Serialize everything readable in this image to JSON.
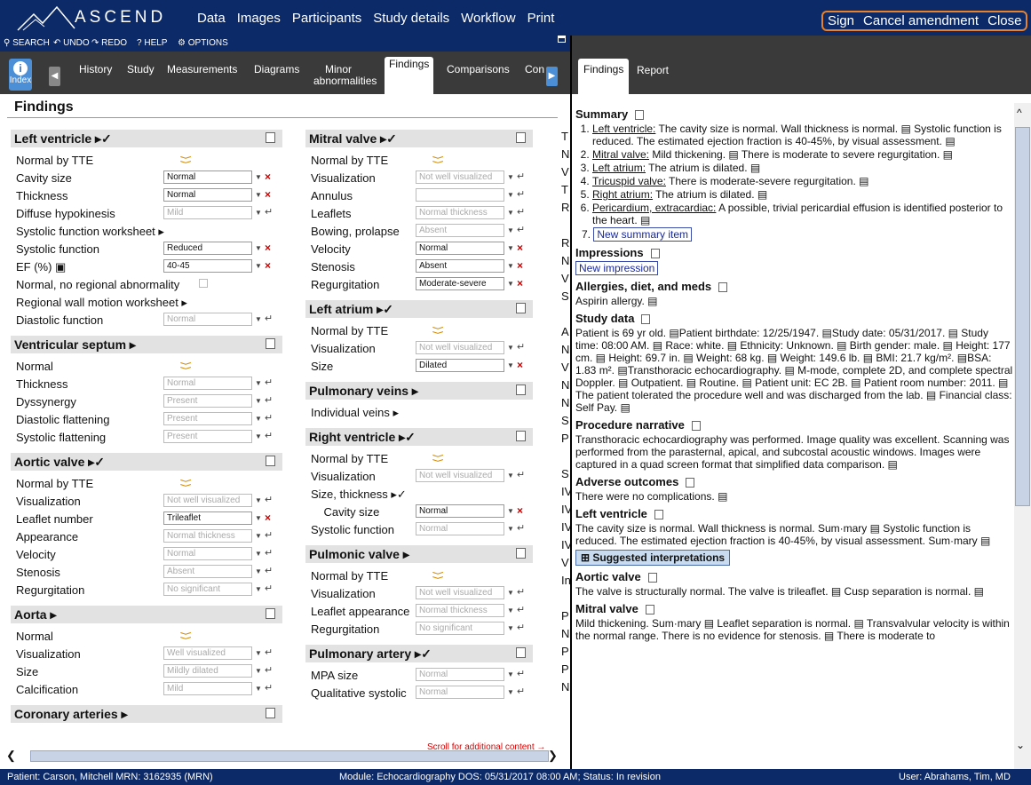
{
  "app": {
    "name": "ASCEND"
  },
  "menu": [
    "Data",
    "Images",
    "Participants",
    "Study details",
    "Workflow",
    "Print"
  ],
  "top_actions": [
    "Sign",
    "Cancel amendment",
    "Close"
  ],
  "toolbar": {
    "search": "SEARCH",
    "undo": "UNDO",
    "redo": "REDO",
    "help": "HELP",
    "options": "OPTIONS"
  },
  "left_tabs": {
    "index": "Index",
    "tabs": [
      "History",
      "Study",
      "Measurements",
      "Diagrams",
      "Minor abnormalities",
      "Findings",
      "Comparisons",
      "Con"
    ],
    "active": "Findings"
  },
  "right_tabs": {
    "tabs": [
      "Findings",
      "Report"
    ],
    "active": "Findings"
  },
  "findings": {
    "title": "Findings"
  },
  "col1": [
    {
      "title": "Left ventricle ▸✓",
      "rows": [
        {
          "label": "Normal by TTE",
          "ctrl": "chevron"
        },
        {
          "label": "Cavity size",
          "value": "Normal",
          "state": "set"
        },
        {
          "label": "Thickness",
          "value": "Normal",
          "state": "set"
        },
        {
          "label": "Diffuse hypokinesis",
          "value": "Mild",
          "state": "dis"
        },
        {
          "label": "Systolic function worksheet ▸",
          "ctrl": "none"
        },
        {
          "label": "Systolic function",
          "value": "Reduced",
          "state": "set"
        },
        {
          "label": "EF (%) ▣",
          "value": "40-45",
          "state": "set"
        },
        {
          "label": "Normal, no regional abnormality",
          "ctrl": "checkbox"
        },
        {
          "label": "Regional wall motion worksheet ▸",
          "ctrl": "none"
        },
        {
          "label": "Diastolic function",
          "value": "Normal",
          "state": "dis"
        }
      ]
    },
    {
      "title": "Ventricular septum ▸",
      "rows": [
        {
          "label": "Normal",
          "ctrl": "chevron"
        },
        {
          "label": "Thickness",
          "value": "Normal",
          "state": "dis"
        },
        {
          "label": "Dyssynergy",
          "value": "Present",
          "state": "dis"
        },
        {
          "label": "Diastolic flattening",
          "value": "Present",
          "state": "dis"
        },
        {
          "label": "Systolic flattening",
          "value": "Present",
          "state": "dis"
        }
      ]
    },
    {
      "title": "Aortic valve ▸✓",
      "rows": [
        {
          "label": "Normal by TTE",
          "ctrl": "chevron"
        },
        {
          "label": "Visualization",
          "value": "Not well visualized",
          "state": "dis"
        },
        {
          "label": "Leaflet number",
          "value": "Trileaflet",
          "state": "set"
        },
        {
          "label": "Appearance",
          "value": "Normal thickness",
          "state": "dis"
        },
        {
          "label": "Velocity",
          "value": "Normal",
          "state": "dis"
        },
        {
          "label": "Stenosis",
          "value": "Absent",
          "state": "dis"
        },
        {
          "label": "Regurgitation",
          "value": "No significant",
          "state": "dis"
        }
      ]
    },
    {
      "title": "Aorta ▸",
      "rows": [
        {
          "label": "Normal",
          "ctrl": "chevron"
        },
        {
          "label": "Visualization",
          "value": "Well visualized",
          "state": "dis"
        },
        {
          "label": "Size",
          "value": "Mildly dilated",
          "state": "dis"
        },
        {
          "label": "Calcification",
          "value": "Mild",
          "state": "dis"
        }
      ]
    },
    {
      "title": "Coronary arteries ▸",
      "rows": []
    }
  ],
  "col2": [
    {
      "title": "Mitral valve ▸✓",
      "rows": [
        {
          "label": "Normal by TTE",
          "ctrl": "chevron"
        },
        {
          "label": "Visualization",
          "value": "Not well visualized",
          "state": "dis"
        },
        {
          "label": "Annulus",
          "value": "",
          "state": "dis"
        },
        {
          "label": "Leaflets",
          "value": "Normal thickness",
          "state": "dis"
        },
        {
          "label": "Bowing, prolapse",
          "value": "Absent",
          "state": "dis"
        },
        {
          "label": "Velocity",
          "value": "Normal",
          "state": "set"
        },
        {
          "label": "Stenosis",
          "value": "Absent",
          "state": "set"
        },
        {
          "label": "Regurgitation",
          "value": "Moderate-severe",
          "state": "set"
        }
      ]
    },
    {
      "title": "Left atrium ▸✓",
      "rows": [
        {
          "label": "Normal by TTE",
          "ctrl": "chevron"
        },
        {
          "label": "Visualization",
          "value": "Not well visualized",
          "state": "dis"
        },
        {
          "label": "Size",
          "value": "Dilated",
          "state": "set"
        }
      ]
    },
    {
      "title": "Pulmonary veins ▸",
      "rows": [
        {
          "label": "Individual veins ▸",
          "ctrl": "none"
        }
      ]
    },
    {
      "title": "Right ventricle ▸✓",
      "rows": [
        {
          "label": "Normal by TTE",
          "ctrl": "chevron"
        },
        {
          "label": "Visualization",
          "value": "Not well visualized",
          "state": "dis"
        },
        {
          "label": "Size, thickness ▸✓",
          "ctrl": "none"
        },
        {
          "label": "    Cavity size",
          "value": "Normal",
          "state": "set"
        },
        {
          "label": "Systolic function",
          "value": "Normal",
          "state": "dis"
        }
      ]
    },
    {
      "title": "Pulmonic valve ▸",
      "rows": [
        {
          "label": "Normal by TTE",
          "ctrl": "chevron"
        },
        {
          "label": "Visualization",
          "value": "Not well visualized",
          "state": "dis"
        },
        {
          "label": "Leaflet appearance",
          "value": "Normal thickness",
          "state": "dis"
        },
        {
          "label": "Regurgitation",
          "value": "No significant",
          "state": "dis"
        }
      ]
    },
    {
      "title": "Pulmonary artery ▸✓",
      "rows": [
        {
          "label": "MPA size",
          "value": "Normal",
          "state": "dis"
        },
        {
          "label": "Qualitative systolic",
          "value": "Normal",
          "state": "dis"
        }
      ]
    }
  ],
  "col3_letters": [
    "T",
    "N",
    "V",
    "T",
    "R",
    "",
    "R",
    "N",
    "V",
    "S",
    "",
    "A",
    "N",
    "V",
    "N",
    "N",
    "S",
    "P",
    "",
    "S",
    "IV",
    "IV",
    "IV",
    "IV",
    "V",
    "In",
    "",
    "P",
    "N",
    "P",
    "P",
    "N"
  ],
  "scroll_msg": "Scroll for additional content →",
  "report": {
    "summary_heading": "Summary",
    "summary": [
      {
        "lead": "Left ventricle:",
        "text": " The cavity size is normal. Wall thickness is normal. ▤ Systolic function is reduced. The estimated ejection fraction is 40-45%, by visual assessment. ▤"
      },
      {
        "lead": "Mitral valve:",
        "text": " Mild thickening. ▤ There is moderate to severe regurgitation. ▤"
      },
      {
        "lead": "Left atrium:",
        "text": " The atrium is dilated. ▤"
      },
      {
        "lead": "Tricuspid valve:",
        "text": " There is moderate-severe regurgitation. ▤"
      },
      {
        "lead": "Right atrium:",
        "text": " The atrium is dilated. ▤"
      },
      {
        "lead": "Pericardium, extracardiac:",
        "text": " A possible, trivial pericardial effusion is identified posterior to the heart. ▤"
      }
    ],
    "new_summary": "New summary item",
    "impressions_heading": "Impressions",
    "new_impression": "New impression",
    "allergies_heading": "Allergies, diet, and meds",
    "allergies": "Aspirin allergy. ▤",
    "study_heading": "Study data",
    "study": "Patient is 69 yr old. ▤Patient birthdate: 12/25/1947. ▤Study date: 05/31/2017. ▤ Study time: 08:00 AM. ▤ Race: white. ▤ Ethnicity: Unknown. ▤ Birth gender: male. ▤ Height: 177 cm. ▤ Height: 69.7 in. ▤ Weight: 68 kg. ▤ Weight: 149.6 lb. ▤ BMI: 21.7 kg/m². ▤BSA: 1.83 m². ▤Transthoracic echocardiography. ▤ M-mode, complete 2D, and complete spectral Doppler. ▤ Outpatient. ▤ Routine. ▤ Patient unit: EC 2B. ▤ Patient room number: 2011. ▤ The patient tolerated the procedure well and was discharged from the lab. ▤ Financial class: Self Pay. ▤",
    "procedure_heading": "Procedure narrative",
    "procedure": "Transthoracic echocardiography was performed. Image quality was excellent. Scanning was performed from the parasternal, apical, and subcostal acoustic windows. Images were captured in a quad screen format that simplified data comparison. ▤",
    "adverse_heading": "Adverse outcomes",
    "adverse": "There were no complications. ▤",
    "lv_heading": "Left ventricle",
    "lv": "The cavity size is normal. Wall thickness is normal. Sum·mary ▤ Systolic function is reduced. The estimated ejection fraction is 40-45%, by visual assessment. Sum·mary ▤",
    "suggested": "⊞ Suggested interpretations",
    "av_heading": "Aortic valve",
    "av": "The valve is structurally normal. The valve is trileaflet. ▤ Cusp separation is normal. ▤",
    "mv_heading": "Mitral valve",
    "mv": "Mild thickening. Sum·mary ▤ Leaflet separation is normal. ▤ Transvalvular velocity is within the normal range. There is no evidence for stenosis. ▤ There is moderate to"
  },
  "status": {
    "patient": "Patient: Carson, Mitchell  MRN: 3162935 (MRN)",
    "module": "Module: Echocardiography  DOS: 05/31/2017 08:00 AM;  Status: In revision",
    "user": "User: Abrahams, Tim, MD"
  },
  "colors": {
    "nav": "#0c2a68",
    "tabbar": "#3a3a3a",
    "highlight": "#e8822a",
    "accent": "#4d8fd6"
  }
}
